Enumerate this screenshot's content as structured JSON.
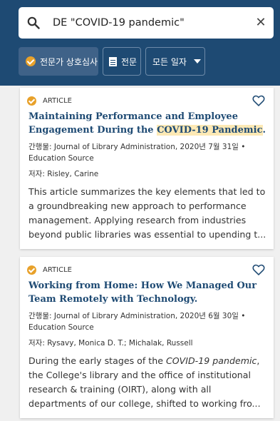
{
  "search": {
    "query": "DE \"COVID-19 pandemic\"",
    "clear_icon": "close-icon"
  },
  "filters": {
    "peer_reviewed": "전문가 상호심사",
    "full_text": "전문",
    "date_range": "모든 일자"
  },
  "results": [
    {
      "type": "ARTICLE",
      "title_before": "Maintaining Performance and Employee Engagement During the ",
      "title_highlight": "COVID-19 Pandemic",
      "title_after": ".",
      "publication": "간행물: Journal of Library Administration, 2020년 7월 31일 • Education Source",
      "authors_label": "저자: ",
      "authors": "Risley, Carine",
      "abstract": "This article summarizes the key elements that led to a groundbreaking new approach to performance management. Applying research from industries beyond public libraries was essential to upending t..."
    },
    {
      "type": "ARTICLE",
      "title": "Working from Home: How We Managed Our Team Remotely with Technology.",
      "publication": "간행물: Journal of Library Administration, 2020년 6월 30일 • Education Source",
      "authors_label": "저자: ",
      "authors": "Rysavy, Monica D. T.; Michalak, Russell",
      "abstract_before": "During the early stages of the ",
      "abstract_italic": "COVID-19 pandemic",
      "abstract_after": ", the College's library and the office of institutional research & training (OIRT), along with all departments of our college, shifted to working fro..."
    }
  ],
  "colors": {
    "header": "#1e4a73",
    "accent": "#e8a12a",
    "highlight": "#fde9b5",
    "title": "#1e4a73"
  }
}
